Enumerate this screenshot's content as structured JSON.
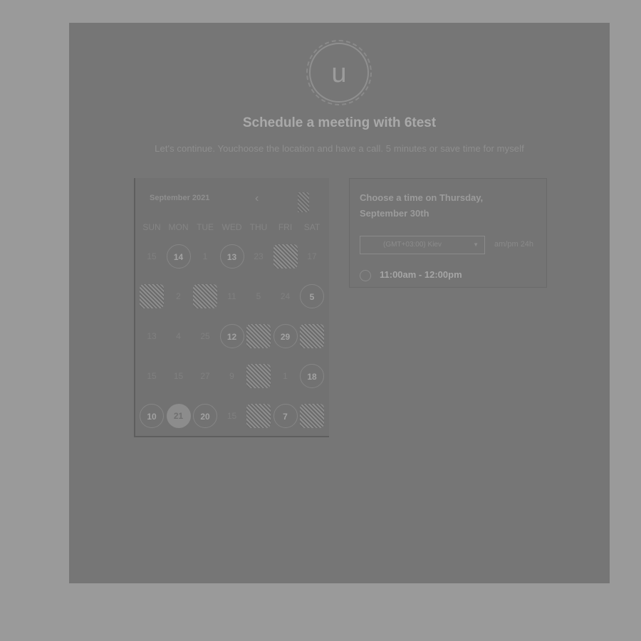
{
  "header": {
    "avatar_letter": "u",
    "title": "Schedule a meeting with 6test",
    "subtitle": "Let's continue. Youchoose the location and have a call. 5 minutes or save time for myself"
  },
  "calendar": {
    "month_label": "September 2021",
    "prev_icon": "‹",
    "weekdays": [
      "SUN",
      "MON",
      "TUE",
      "WED",
      "THU",
      "FRI",
      "SAT"
    ],
    "rows": [
      [
        "15",
        "14",
        "1",
        "13",
        "23",
        "",
        "17"
      ],
      [
        "",
        "2",
        "",
        "11",
        "5",
        "24",
        "5"
      ],
      [
        "13",
        "4",
        "25",
        "12",
        "",
        "29",
        ""
      ],
      [
        "15",
        "15",
        "27",
        "9",
        "",
        "1",
        "18"
      ],
      [
        "10",
        "21",
        "20",
        "15",
        "",
        "7",
        ""
      ]
    ],
    "selected_day": "21"
  },
  "time_panel": {
    "heading": "Choose a time on Thursday, September 30th",
    "timezone": "(GMT+03:00) Kiev",
    "format_ampm": "am/pm",
    "format_24h": "24h",
    "slot": "11:00am - 12:00pm"
  },
  "colors": {
    "background": "#9a9a9a",
    "panel": "#767676"
  }
}
